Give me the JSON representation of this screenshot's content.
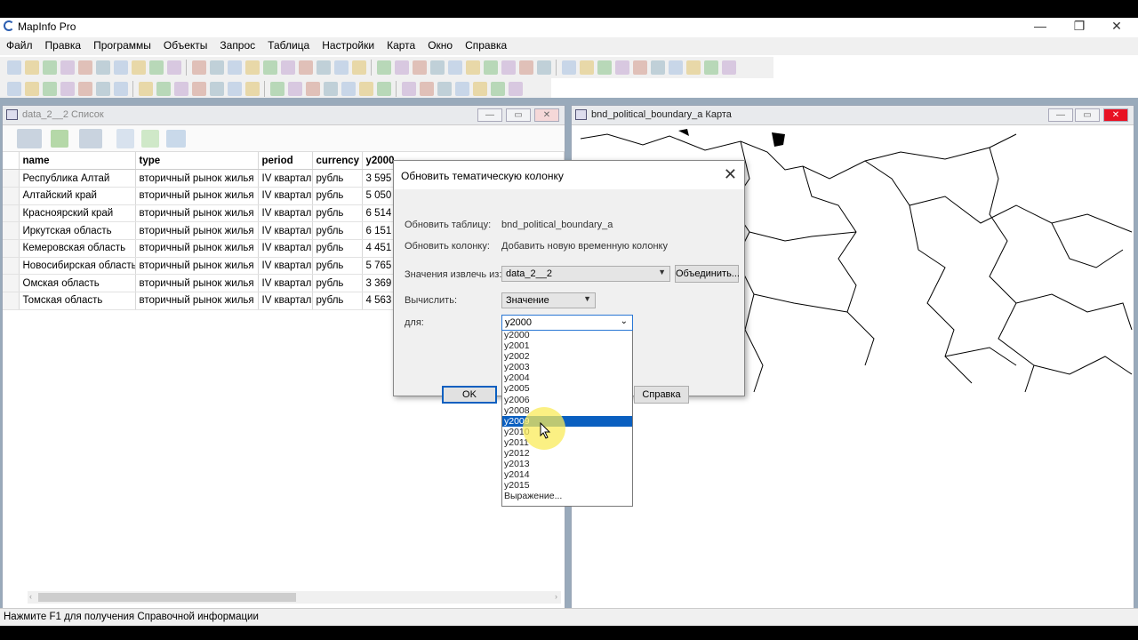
{
  "app": {
    "title": "MapInfo Pro"
  },
  "menu": [
    "Файл",
    "Правка",
    "Программы",
    "Объекты",
    "Запрос",
    "Таблица",
    "Настройки",
    "Карта",
    "Окно",
    "Справка"
  ],
  "browser": {
    "title": "data_2__2 Список",
    "columns": [
      "name",
      "type",
      "period",
      "currency",
      "y2000"
    ],
    "rows": [
      [
        "Республика Алтай",
        "вторичный рынок жилья",
        "IV квартал",
        "рубль",
        "3 595"
      ],
      [
        "Алтайский край",
        "вторичный рынок жилья",
        "IV квартал",
        "рубль",
        "5 050"
      ],
      [
        "Красноярский край",
        "вторичный рынок жилья",
        "IV квартал",
        "рубль",
        "6 514"
      ],
      [
        "Иркутская область",
        "вторичный рынок жилья",
        "IV квартал",
        "рубль",
        "6 151"
      ],
      [
        "Кемеровская область",
        "вторичный рынок жилья",
        "IV квартал",
        "рубль",
        "4 451"
      ],
      [
        "Новосибирская область",
        "вторичный рынок жилья",
        "IV квартал",
        "рубль",
        "5 765"
      ],
      [
        "Омская область",
        "вторичный рынок жилья",
        "IV квартал",
        "рубль",
        "3 369"
      ],
      [
        "Томская область",
        "вторичный рынок жилья",
        "IV квартал",
        "рубль",
        "4 563"
      ]
    ]
  },
  "map": {
    "title": "bnd_political_boundary_a Карта"
  },
  "dialog": {
    "title": "Обновить тематическую колонку",
    "update_table_label": "Обновить таблицу:",
    "update_table_value": "bnd_political_boundary_a",
    "update_column_label": "Обновить колонку:",
    "update_column_value": "Добавить новую временную колонку",
    "source_label": "Значения извлечь из:",
    "source_value": "data_2__2",
    "join_button": "Объединить...",
    "calc_label": "Вычислить:",
    "calc_value": "Значение",
    "for_label": "для:",
    "for_value": "y2000",
    "ok_button": "OK",
    "help_button": "Справка"
  },
  "dropdown": {
    "options": [
      "y2000",
      "y2001",
      "y2002",
      "y2003",
      "y2004",
      "y2005",
      "y2006",
      "y2008",
      "y2009",
      "y2010",
      "y2011",
      "y2012",
      "y2013",
      "y2014",
      "y2015",
      "Выражение..."
    ],
    "selected": "y2009"
  },
  "status": {
    "text": "Нажмите F1 для получения Справочной информации"
  },
  "colors": {
    "selection": "#0a5fc0",
    "menubar": "#f0f0f0",
    "mdi_bg": "#9ab"
  }
}
